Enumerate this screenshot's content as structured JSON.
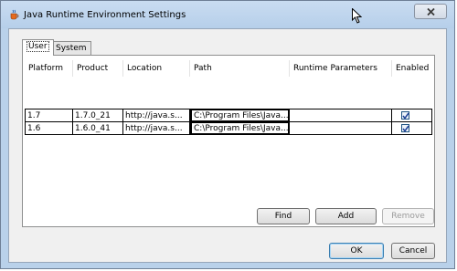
{
  "window": {
    "title": "Java Runtime Environment Settings"
  },
  "tabs": [
    {
      "label": "User",
      "active": true
    },
    {
      "label": "System",
      "active": false
    }
  ],
  "table": {
    "columns": [
      "Platform",
      "Product",
      "Location",
      "Path",
      "Runtime Parameters",
      "Enabled"
    ],
    "rows": [
      {
        "platform": "1.7",
        "product": "1.7.0_21",
        "location": "http://java.s...",
        "path": "C:\\Program Files\\Java...",
        "runtime_parameters": "",
        "enabled": true
      },
      {
        "platform": "1.6",
        "product": "1.6.0_41",
        "location": "http://java.s...",
        "path": "C:\\Program Files\\Java...",
        "runtime_parameters": "",
        "enabled": true
      }
    ]
  },
  "buttons": {
    "find": "Find",
    "add": "Add",
    "remove": "Remove",
    "ok": "OK",
    "cancel": "Cancel"
  },
  "icons": {
    "app": "java-cup-icon",
    "close": "close-icon",
    "cursor": "mouse-pointer-icon",
    "checkbox": "checkmark-icon"
  },
  "colors": {
    "window_frame": "#b9d1ea",
    "client_bg": "#f0f0f0",
    "checkbox_check": "#1c3f95"
  }
}
